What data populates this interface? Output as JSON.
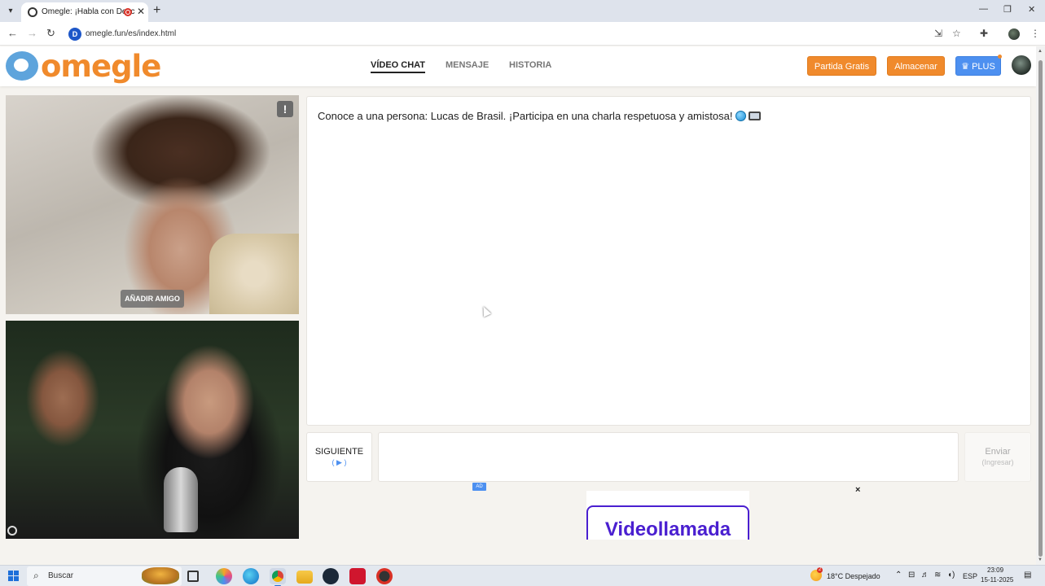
{
  "browser": {
    "tab_title": "Omegle: ¡Habla con Desco",
    "tab_close": "✕",
    "new_tab": "+",
    "url": "omegle.fun/es/index.html",
    "site_badge": "D",
    "window_controls": [
      "—",
      "❐",
      "✕"
    ],
    "icons": [
      "tab-list-icon",
      "back-icon",
      "forward-icon",
      "reload-icon",
      "install-icon",
      "star-icon",
      "extensions-icon",
      "profile-icon",
      "menu-icon"
    ]
  },
  "site": {
    "logo_text": "omegle",
    "nav": [
      {
        "label": "VÍDEO CHAT",
        "active": true
      },
      {
        "label": "MENSAJE",
        "active": false
      },
      {
        "label": "HISTORIA",
        "active": false
      }
    ],
    "buttons": {
      "free_match": "Partida Gratis",
      "store": "Almacenar",
      "plus": "PLUS"
    },
    "colors": {
      "brand_orange": "#f08a2c",
      "brand_blue": "#4d90f0",
      "logo_blue": "#5ea4dc"
    }
  },
  "video": {
    "report_label": "!",
    "add_friend_label": "AÑADIR AMIGO"
  },
  "chat": {
    "message": "Conoce a una persona: Lucas de Brasil. ¡Participa en una charla respetuosa y amistosa!",
    "next_label": "SIGUIENTE",
    "next_hint": "( ▶ )",
    "send_label": "Enviar",
    "send_hint": "(Ingresar)",
    "input_value": ""
  },
  "ad": {
    "badge": "AD",
    "text": "Videollamada",
    "close": "×"
  },
  "taskbar": {
    "search_label": "Buscar",
    "weather_badge": "2",
    "weather": "18°C  Despejado",
    "language": "ESP",
    "time": "23:09",
    "date": "15-11-2025",
    "apps": [
      "task-view-icon",
      "copilot-icon",
      "edge-icon",
      "chrome-icon",
      "file-explorer-icon",
      "steam-icon",
      "opera-icon",
      "obs-icon"
    ]
  }
}
